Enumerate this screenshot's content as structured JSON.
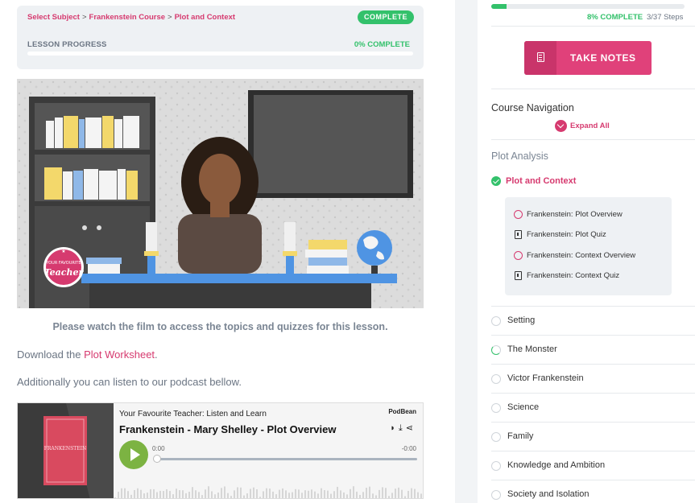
{
  "breadcrumb": {
    "items": [
      "Select Subject",
      "Frankenstein Course",
      "Plot and Context"
    ],
    "separator": ">"
  },
  "lesson_status": "COMPLETE",
  "lesson_progress": {
    "label": "LESSON PROGRESS",
    "percent_text": "0% COMPLETE",
    "percent": 0
  },
  "video": {
    "badge_line1": "YOUR FAVOURITE",
    "badge_line2": "Teacher",
    "badge_star": "★"
  },
  "watch_note": "Please watch the film to access the topics and quizzes for this lesson.",
  "download": {
    "prefix": "Download the ",
    "link": "Plot Worksheet",
    "suffix": "."
  },
  "podcast_note": "Additionally you can listen to our podcast bellow.",
  "player": {
    "show_name": "Your Favourite Teacher: Listen and Learn",
    "episode_title": "Frankenstein - Mary Shelley - Plot Overview",
    "brand": "PodBean",
    "time_start": "0:00",
    "time_end": "-0:00",
    "cover_text": "FRANKENSTEIN",
    "icons": [
      "rss-icon",
      "download-icon",
      "share-icon"
    ]
  },
  "course_progress": {
    "percent_text": "8% COMPLETE",
    "steps_text": "3/37 Steps",
    "percent": 8
  },
  "take_notes_label": "TAKE NOTES",
  "course_nav": {
    "title": "Course Navigation",
    "expand_label": "Expand All"
  },
  "section_title": "Plot Analysis",
  "active_lesson": "Plot and Context",
  "topics": [
    {
      "label": "Frankenstein: Plot Overview",
      "kind": "topic"
    },
    {
      "label": "Frankenstein: Plot Quiz",
      "kind": "quiz"
    },
    {
      "label": "Frankenstein: Context Overview",
      "kind": "topic"
    },
    {
      "label": "Frankenstein: Context Quiz",
      "kind": "quiz"
    }
  ],
  "lessons": [
    {
      "label": "Setting",
      "state": "empty"
    },
    {
      "label": "The Monster",
      "state": "partial"
    },
    {
      "label": "Victor Frankenstein",
      "state": "empty"
    },
    {
      "label": "Science",
      "state": "empty"
    },
    {
      "label": "Family",
      "state": "empty"
    },
    {
      "label": "Knowledge and Ambition",
      "state": "empty"
    },
    {
      "label": "Society and Isolation",
      "state": "empty"
    }
  ],
  "colors": {
    "accent": "#d63a6f",
    "success": "#33c16b",
    "button": "#e0417a",
    "play": "#7cb342"
  }
}
